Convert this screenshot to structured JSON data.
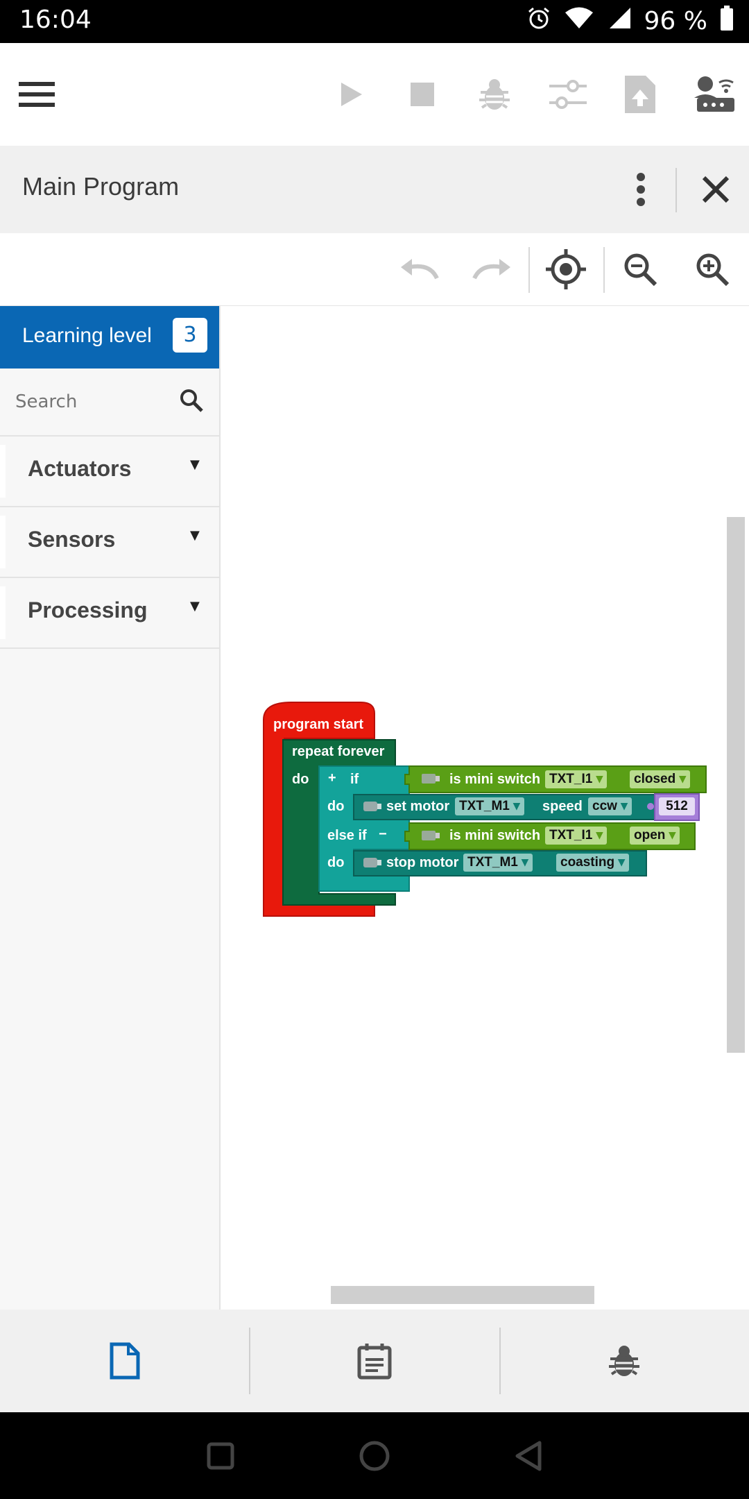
{
  "status_bar": {
    "time": "16:04",
    "battery": "96 %"
  },
  "title_bar": {
    "title": "Main Program"
  },
  "sidebar": {
    "level_label": "Learning level",
    "level_value": "3",
    "search_placeholder": "Search",
    "categories": [
      {
        "label": "Actuators"
      },
      {
        "label": "Sensors"
      },
      {
        "label": "Processing"
      }
    ]
  },
  "program": {
    "start": "program start",
    "repeat": "repeat forever",
    "do": "do",
    "if_label": "if",
    "plus": "+",
    "minus": "−",
    "else_if_label": "else if",
    "switch_label": "is mini switch",
    "switch1_port": "TXT_I1",
    "switch1_state": "closed",
    "set_motor_label": "set motor",
    "motor_port": "TXT_M1",
    "speed_label": "speed",
    "direction": "ccw",
    "speed_value": "512",
    "switch2_port": "TXT_I1",
    "switch2_state": "open",
    "stop_motor_label": "stop motor",
    "stop_motor_port": "TXT_M1",
    "stop_mode": "coasting",
    "dropdown_arrow": "▾"
  },
  "colors": {
    "accent": "#0a67b4",
    "program_start": "#e8190c",
    "repeat": "#0e6b3f",
    "if_block": "#13a39a",
    "action_block": "#0e7f73",
    "sensor_block": "#5a9f16",
    "number_block": "#a57fd8"
  }
}
